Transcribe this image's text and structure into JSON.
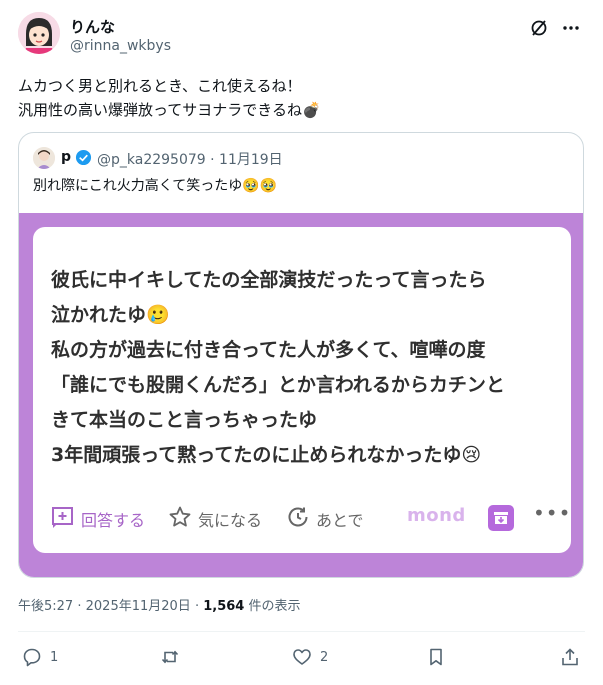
{
  "author": {
    "display_name": "りんな",
    "handle": "@rinna_wkbys"
  },
  "tweet": {
    "lines": [
      "ムカつく男と別れるとき、これ使えるね！",
      "汎用性の高い爆弾放ってサヨナラできるね💣"
    ]
  },
  "quote": {
    "display_name": "p",
    "handle": "@p_ka2295079",
    "separator": "·",
    "date": "11月19日",
    "text": "別れ際にこれ火力高くて笑ったゆ🥹🥹",
    "media": {
      "lines": [
        "彼氏に中イキしてたの全部演技だったって言ったら",
        "泣かれたゆ🥲",
        "私の方が過去に付き合ってた人が多くて、喧嘩の度",
        "「誰にでも股開くんだろ」とか言われるからカチンと",
        "きて本当のこと言っちゃったゆ",
        "3年間頑張って黙ってたのに止められなかったゆ😢"
      ],
      "actions": {
        "answer": "回答する",
        "interested": "気になる",
        "later": "あとで"
      },
      "brand": "mond",
      "more": "•••",
      "accent_color": "#bd84d8"
    }
  },
  "meta": {
    "time": "午後5:27",
    "separator": "·",
    "date": "2025年11月20日",
    "views_count": "1,564",
    "views_label": "件の表示"
  },
  "actions": {
    "reply_count": "1",
    "repost_count": "",
    "like_count": "2"
  },
  "icons": [
    "grok-icon",
    "more-icon",
    "verified-icon",
    "reply-icon",
    "repost-icon",
    "like-icon",
    "bookmark-icon",
    "share-icon"
  ]
}
